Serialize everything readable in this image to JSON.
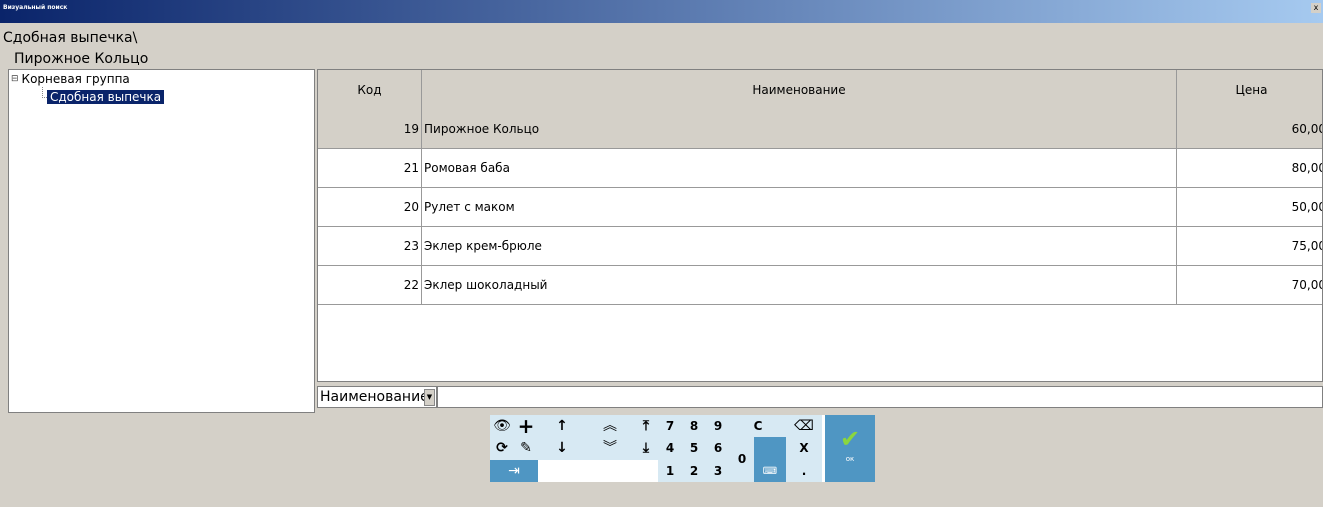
{
  "window": {
    "title": "Визуальный поиск",
    "close": "x"
  },
  "breadcrumb": "Сдобная выпечка\\",
  "selected_item": "Пирожное Кольцо",
  "tree": {
    "root": "Корневая группа",
    "child": "Сдобная выпечка",
    "expander": "⊟"
  },
  "grid": {
    "headers": {
      "code": "Код",
      "name": "Наименование",
      "price": "Цена"
    },
    "rows": [
      {
        "code": "19",
        "name": "Пирожное Кольцо",
        "price": "60,00"
      },
      {
        "code": "21",
        "name": "Ромовая баба",
        "price": "80,00"
      },
      {
        "code": "20",
        "name": "Рулет с маком",
        "price": "50,00"
      },
      {
        "code": "23",
        "name": "Эклер крем-брюле",
        "price": "75,00"
      },
      {
        "code": "22",
        "name": "Эклер шоколадный",
        "price": "70,00"
      }
    ]
  },
  "search": {
    "field": "Наименование",
    "value": ""
  },
  "keypad": {
    "k7": "7",
    "k8": "8",
    "k9": "9",
    "k4": "4",
    "k5": "5",
    "k6": "6",
    "k1": "1",
    "k2": "2",
    "k3": "3",
    "k0": "0",
    "clear": "C",
    "mult": "X",
    "dot": ".",
    "ok": "ок"
  },
  "icons": {
    "eye": "eye-icon",
    "plus": "plus-icon",
    "up": "arrow-up-icon",
    "page_up": "double-chevron-up-icon",
    "first": "arrow-top-icon",
    "backspace": "backspace-icon",
    "refresh": "refresh-icon",
    "edit": "edit-icon",
    "down": "arrow-down-icon",
    "page_down": "double-chevron-down-icon",
    "last": "arrow-bottom-icon",
    "exit": "exit-icon",
    "keyboard": "keyboard-icon",
    "check": "check-icon"
  },
  "colors": {
    "title_start": "#0a246a",
    "title_end": "#a6caf0",
    "key": "#d7e9f3",
    "key_dark": "#4f96c3",
    "check": "#8bd63e"
  }
}
